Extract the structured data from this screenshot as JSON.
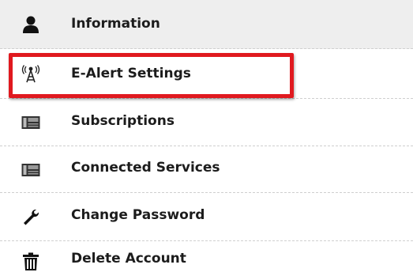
{
  "menu": {
    "items": [
      {
        "label": "Information",
        "icon": "user-icon"
      },
      {
        "label": "E-Alert Settings",
        "icon": "broadcast-tower-icon"
      },
      {
        "label": "Subscriptions",
        "icon": "newspaper-icon"
      },
      {
        "label": "Connected Services",
        "icon": "newspaper-icon"
      },
      {
        "label": "Change Password",
        "icon": "wrench-icon"
      },
      {
        "label": "Delete Account",
        "icon": "trash-icon"
      }
    ]
  },
  "colors": {
    "active_background": "#eeeeee",
    "highlight_border": "#e0191f",
    "divider": "#cfcfcf",
    "text": "#1c1c1c"
  }
}
